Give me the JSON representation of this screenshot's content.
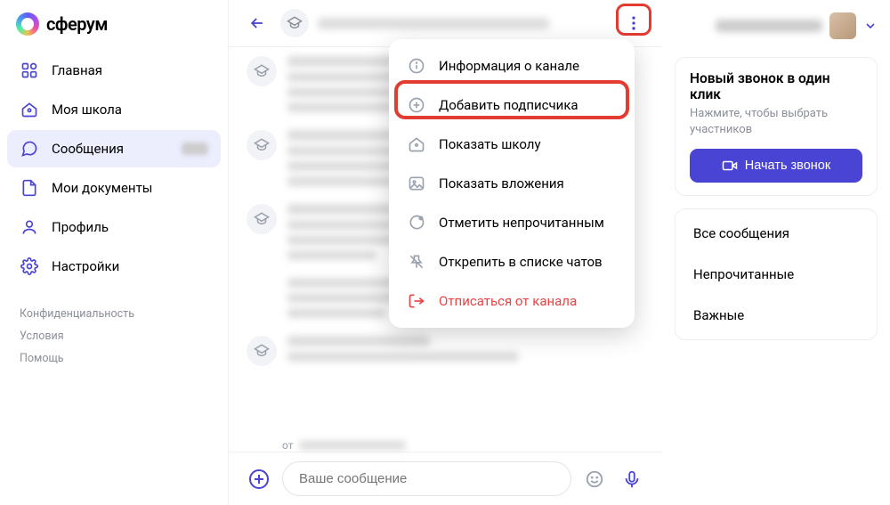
{
  "brand": "сферум",
  "sidebar": {
    "items": [
      {
        "label": "Главная"
      },
      {
        "label": "Моя школа"
      },
      {
        "label": "Сообщения"
      },
      {
        "label": "Мои документы"
      },
      {
        "label": "Профиль"
      },
      {
        "label": "Настройки"
      }
    ]
  },
  "footer": {
    "privacy": "Конфиденциальность",
    "terms": "Условия",
    "help": "Помощь"
  },
  "dropdown": {
    "info": "Информация о канале",
    "add_subscriber": "Добавить подписчика",
    "show_school": "Показать школу",
    "show_attachments": "Показать вложения",
    "mark_unread": "Отметить непрочитанным",
    "unpin": "Открепить в списке чатов",
    "unsubscribe": "Отписаться от канала"
  },
  "call_card": {
    "title": "Новый звонок в один клик",
    "subtitle": "Нажмите, чтобы выбрать участников",
    "button": "Начать звонок"
  },
  "filters": {
    "all": "Все сообщения",
    "unread": "Непрочитанные",
    "important": "Важные"
  },
  "composer": {
    "placeholder": "Ваше сообщение",
    "from_label": "от"
  }
}
